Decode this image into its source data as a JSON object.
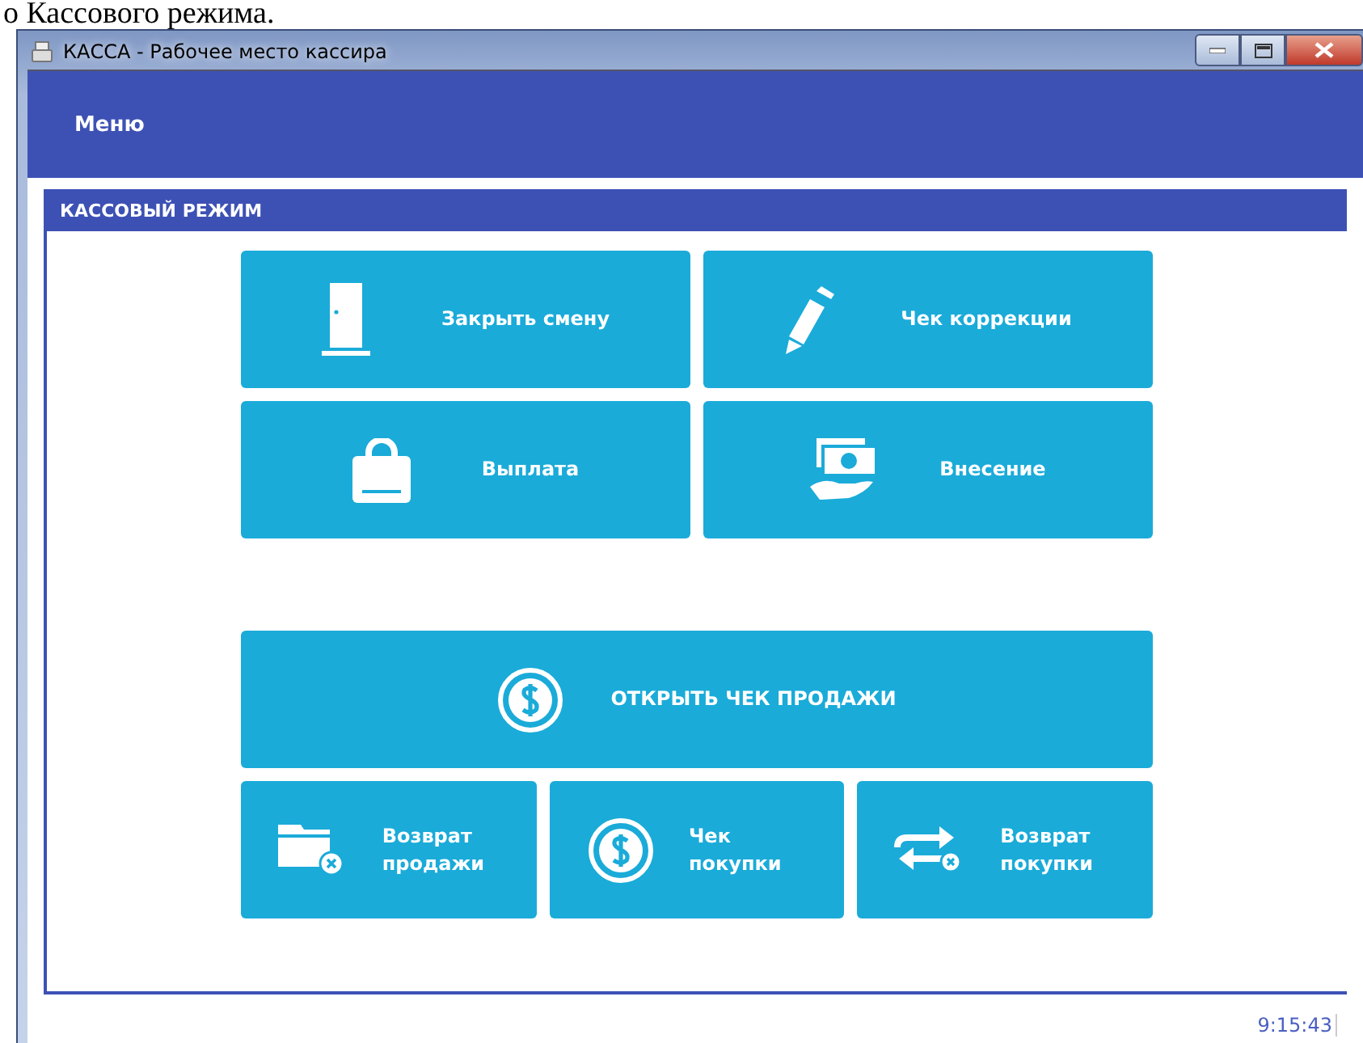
{
  "document_text": "о Кассового режима.",
  "window": {
    "title": "КАССА - Рабочее место кассира"
  },
  "menu": {
    "label": "Меню"
  },
  "panel": {
    "title": "КАССОВЫЙ РЕЖИМ"
  },
  "top_actions": [
    {
      "label": "Закрыть смену"
    },
    {
      "label": "Чек коррекции"
    },
    {
      "label": "Выплата"
    },
    {
      "label": "Внесение"
    }
  ],
  "main_action": {
    "label": "ОТКРЫТЬ ЧЕК ПРОДАЖИ"
  },
  "bottom_actions": [
    {
      "label": "Возврат продажи"
    },
    {
      "label": "Чек покупки"
    },
    {
      "label": "Возврат покупки"
    }
  ],
  "status_bar": {
    "time": "9:15:43"
  }
}
